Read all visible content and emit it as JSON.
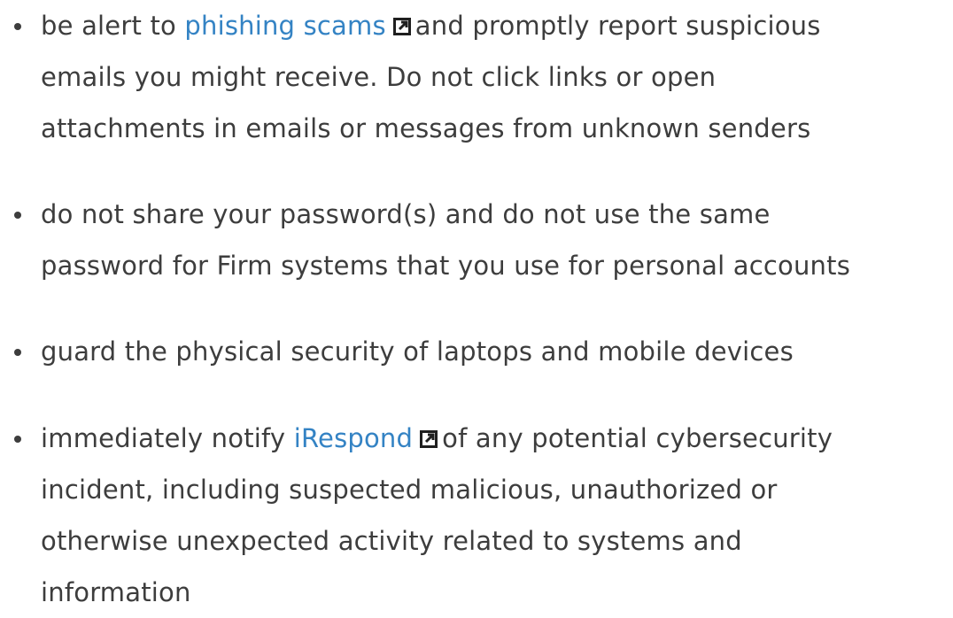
{
  "items": [
    {
      "line1_prefix": "be alert to ",
      "link": "phishing scams",
      "line1_suffix": "and promptly report suspicious",
      "line2": "emails you might receive. Do not click links or open",
      "line3": "attachments in emails or messages from unknown senders"
    },
    {
      "line1": "do not share your password(s) and do not use the same",
      "line2": "password for Firm systems that you use for personal accounts"
    },
    {
      "line1": "guard the physical security of laptops and mobile devices"
    },
    {
      "line1_prefix": "immediately notify ",
      "link": "iRespond",
      "line1_suffix": "of any potential cybersecurity",
      "line2": "incident, including suspected malicious, unauthorized or",
      "line3": "otherwise unexpected activity related to systems and",
      "line4": "information"
    }
  ],
  "icons": {
    "external_link": "external-link-icon"
  },
  "colors": {
    "text": "#3d3d3d",
    "link": "#3483c4"
  }
}
